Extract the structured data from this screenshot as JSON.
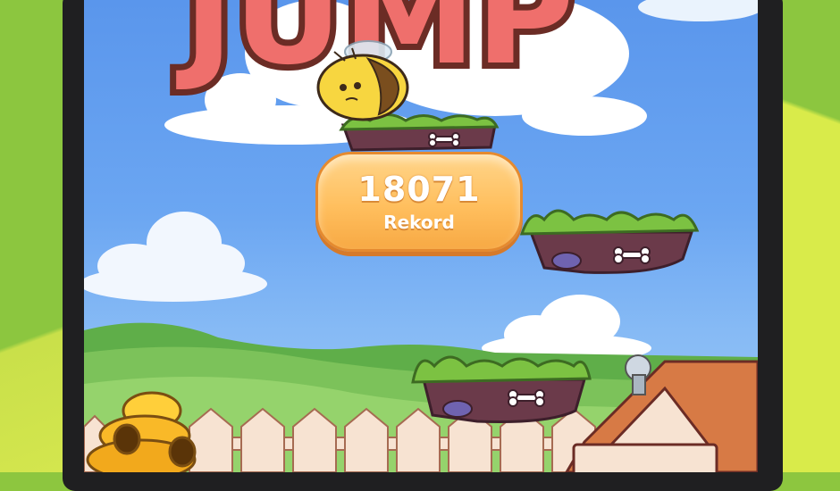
{
  "game": {
    "title": "JUMP",
    "score": {
      "value": "18071",
      "label": "Rekord"
    }
  },
  "colors": {
    "sky": "#6ba6f2",
    "title_fill": "#ef6f6c",
    "title_outline": "#6b2c25",
    "score_box": "#ffc46a",
    "grass": "#7cc242",
    "dirt": "#6b3a4a",
    "fence": "#f7e3d2",
    "roof": "#d77a45",
    "frame_left": "#8cc63f",
    "frame_right": "#d9eb4a"
  },
  "icons": [
    "bee-character-icon",
    "beehive-icon",
    "bone-icon",
    "doghouse-icon"
  ]
}
